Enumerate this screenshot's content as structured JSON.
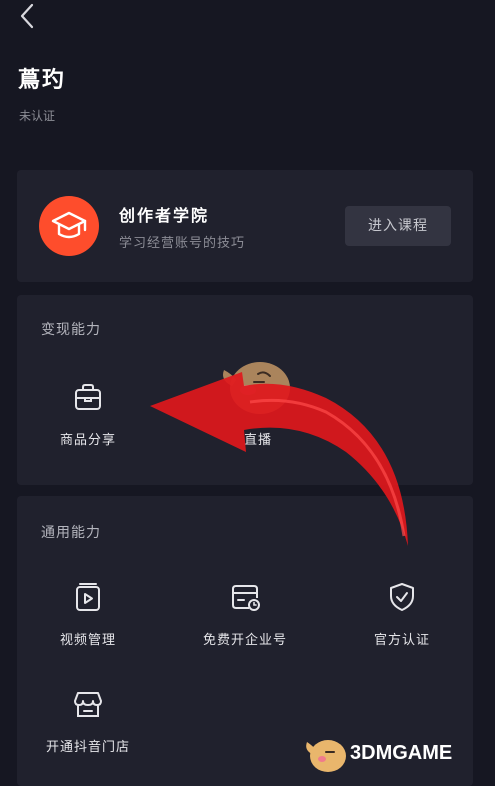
{
  "header": {
    "back_icon": "chevron-left-icon",
    "user_name": "蔦玓",
    "verify_status": "未认证"
  },
  "academy": {
    "title": "创作者学院",
    "subtitle": "学习经营账号的技巧",
    "button_label": "进入课程",
    "icon": "graduation-cap-icon",
    "icon_bg_color": "#fe4d2c"
  },
  "monetize": {
    "title": "变现能力",
    "items": [
      {
        "label": "商品分享",
        "icon": "shopping-bag-icon"
      },
      {
        "label": "直播",
        "icon": "live-icon"
      }
    ]
  },
  "general": {
    "title": "通用能力",
    "items": [
      {
        "label": "视频管理",
        "icon": "video-manage-icon"
      },
      {
        "label": "免费开企业号",
        "icon": "enterprise-card-icon"
      },
      {
        "label": "官方认证",
        "icon": "shield-check-icon"
      },
      {
        "label": "开通抖音门店",
        "icon": "storefront-icon"
      }
    ]
  },
  "overlay": {
    "arrow_color": "#e0181c"
  },
  "watermark": {
    "text": "3DMGAME"
  },
  "colors": {
    "background": "#161722",
    "card": "#20212d",
    "accent": "#fe4d2c"
  }
}
